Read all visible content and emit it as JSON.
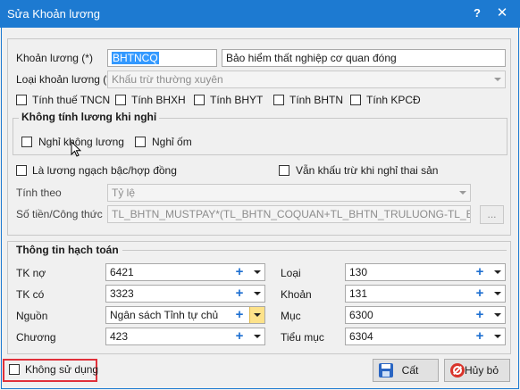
{
  "window": {
    "title": "Sửa Khoản lương",
    "help_label": "?",
    "close_label": "✕"
  },
  "form": {
    "khoan_luong_label": "Khoản lương (*)",
    "khoan_luong_code": "BHTNCQ",
    "khoan_luong_name": "Bảo hiểm thất nghiệp cơ quan đóng",
    "loai_label": "Loại khoản lương (*)",
    "loai_value": "Khấu trừ thường xuyên",
    "checks": [
      {
        "label": "Tính thuế TNCN",
        "checked": false
      },
      {
        "label": "Tính BHXH",
        "checked": false
      },
      {
        "label": "Tính BHYT",
        "checked": false
      },
      {
        "label": "Tính BHTN",
        "checked": false
      },
      {
        "label": "Tính KPCĐ",
        "checked": false
      }
    ],
    "khong_tinh_title": "Không tính lương khi nghỉ",
    "nghi_khong_luong": "Nghỉ không lương",
    "nghi_om": "Nghỉ ốm",
    "la_luong_ngach": "Là lương ngạch bậc/hợp đồng",
    "van_khau_tru": "Vẫn khấu trừ khi nghỉ thai sản",
    "tinh_theo_label": "Tính theo",
    "tinh_theo_value": "Tỷ lệ",
    "so_tien_label": "Số tiền/Công thức",
    "so_tien_value": "TL_BHTN_MUSTPAY*(TL_BHTN_COQUAN+TL_BHTN_TRULUONG-TL_BHT",
    "ellipsis": "..."
  },
  "hach_toan": {
    "title": "Thông tin hạch toán",
    "left": [
      {
        "label": "TK nợ",
        "value": "6421"
      },
      {
        "label": "TK có",
        "value": "3323"
      },
      {
        "label": "Nguồn",
        "value": "Ngân sách Tỉnh tự chủ"
      },
      {
        "label": "Chương",
        "value": "423"
      }
    ],
    "right": [
      {
        "label": "Loại",
        "value": "130"
      },
      {
        "label": "Khoản",
        "value": "131"
      },
      {
        "label": "Mục",
        "value": "6300"
      },
      {
        "label": "Tiểu mục",
        "value": "6304"
      }
    ],
    "plus": "+"
  },
  "footer": {
    "khong_su_dung": "Không sử dụng",
    "save_label": "Cất",
    "cancel_label": "Hủy bỏ"
  },
  "colors": {
    "titlebar": "#1d7ad1",
    "highlight": "#e0303a"
  }
}
